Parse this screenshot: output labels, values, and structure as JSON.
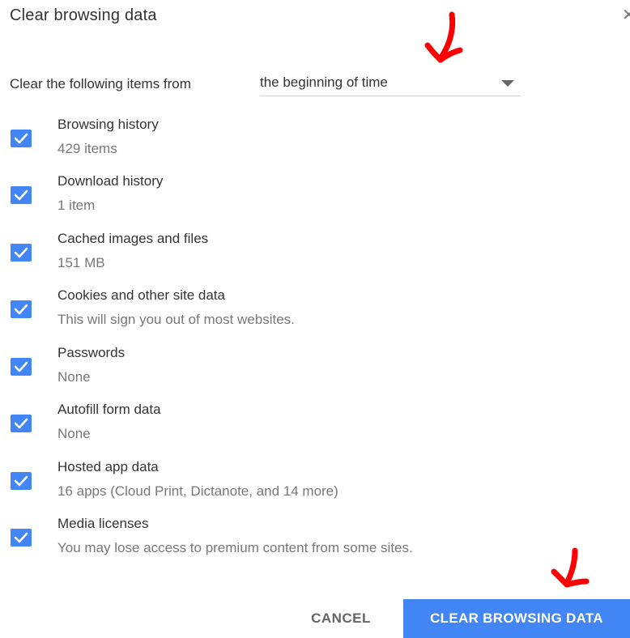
{
  "dialog": {
    "title": "Clear browsing data",
    "close_icon": "close-icon"
  },
  "range": {
    "label": "Clear the following items from",
    "selected": "the beginning of time"
  },
  "items": [
    {
      "title": "Browsing history",
      "subtitle": "429 items",
      "checked": true
    },
    {
      "title": "Download history",
      "subtitle": "1 item",
      "checked": true
    },
    {
      "title": "Cached images and files",
      "subtitle": "151 MB",
      "checked": true
    },
    {
      "title": "Cookies and other site data",
      "subtitle": "This will sign you out of most websites.",
      "checked": true
    },
    {
      "title": "Passwords",
      "subtitle": "None",
      "checked": true
    },
    {
      "title": "Autofill form data",
      "subtitle": "None",
      "checked": true
    },
    {
      "title": "Hosted app data",
      "subtitle": "16 apps (Cloud Print, Dictanote, and 14 more)",
      "checked": true
    },
    {
      "title": "Media licenses",
      "subtitle": "You may lose access to premium content from some sites.",
      "checked": true
    }
  ],
  "buttons": {
    "cancel": "CANCEL",
    "clear": "CLEAR BROWSING DATA"
  },
  "colors": {
    "accent": "#4285f4",
    "annotation": "#ff0000"
  }
}
